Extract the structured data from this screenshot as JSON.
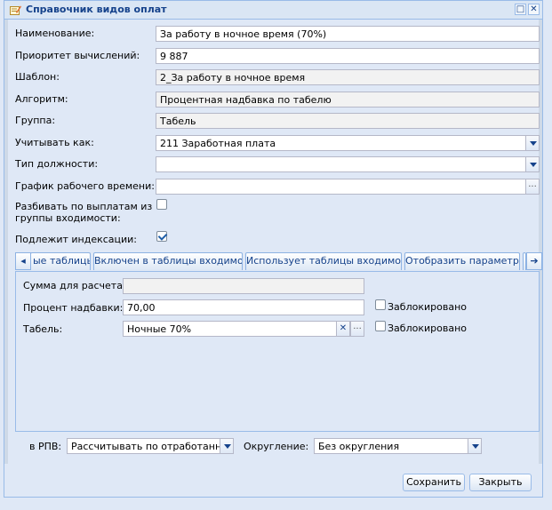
{
  "window": {
    "title": "Справочник видов оплат",
    "restore_glyph": "□",
    "close_glyph": "✕"
  },
  "form": {
    "name": {
      "label": "Наименование:",
      "value": "За работу в ночное время (70%)"
    },
    "priority": {
      "label": "Приоритет вычислений:",
      "value": "9 887"
    },
    "template": {
      "label": "Шаблон:",
      "value": "2_За работу в ночное время"
    },
    "algorithm": {
      "label": "Алгоритм:",
      "value": "Процентная надбавка по табелю"
    },
    "group": {
      "label": "Группа:",
      "value": "Табель"
    },
    "account_as": {
      "label": "Учитывать как:",
      "value": "211 Заработная плата"
    },
    "position_type": {
      "label": "Тип должности:",
      "value": ""
    },
    "schedule": {
      "label": "График рабочего времени:",
      "value": "",
      "trigger": "..."
    },
    "split_payments": {
      "label_line1": "Разбивать по выплатам из",
      "label_line2": "группы входимости:",
      "checked": false
    },
    "indexation": {
      "label": "Подлежит индексации:",
      "checked": true
    }
  },
  "tabs": [
    {
      "label": "ые таблицы"
    },
    {
      "label": "Включен в таблицы входимости"
    },
    {
      "label": "Использует таблицы входимости"
    },
    {
      "label": "Отобразить параметры"
    }
  ],
  "tab_scroll": {
    "left": "◆",
    "right": "➔"
  },
  "params": {
    "base_sum": {
      "label": "Сумма для расчета:",
      "value": ""
    },
    "percent": {
      "label": "Процент надбавки:",
      "value": "70,00",
      "lock_label": "Заблокировано",
      "locked": false
    },
    "timesheet": {
      "label": "Табель:",
      "value": "Ночные 70%",
      "clear": "✕",
      "trigger": "...",
      "lock_label": "Заблокировано",
      "locked": false
    }
  },
  "bottom": {
    "rpv_label": "в РПВ:",
    "rpv_value": "Рассчитывать по отработанному",
    "rounding_label": "Округление:",
    "rounding_value": "Без округления"
  },
  "buttons": {
    "save": "Сохранить",
    "close": "Закрыть"
  }
}
